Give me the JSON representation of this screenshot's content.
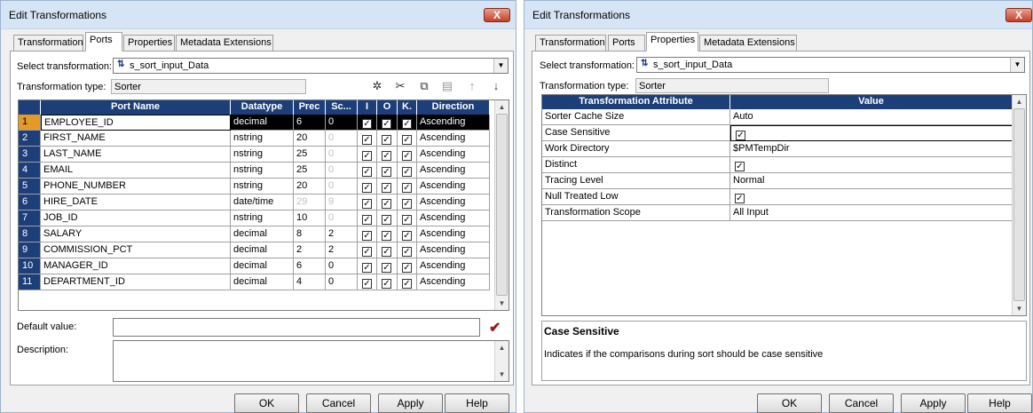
{
  "left": {
    "title": "Edit Transformations",
    "close": "X",
    "tabs": [
      "Transformation",
      "Ports",
      "Properties",
      "Metadata Extensions"
    ],
    "select_label": "Select transformation:",
    "select_value": "s_sort_input_Data",
    "type_label": "Transformation type:",
    "type_value": "Sorter",
    "toolbar_icons": [
      "new-port-icon",
      "cut-icon",
      "copy-icon",
      "paste-icon",
      "move-up-icon",
      "move-down-icon"
    ],
    "columns": [
      "",
      "Port Name",
      "Datatype",
      "Prec",
      "Sc...",
      "I",
      "O",
      "K.",
      "Direction"
    ],
    "rows": [
      {
        "n": "1",
        "name": "EMPLOYEE_ID",
        "type": "decimal",
        "prec": "6",
        "scale": "0",
        "scale_disabled": false,
        "prec_disabled": false,
        "dir": "Ascending"
      },
      {
        "n": "2",
        "name": "FIRST_NAME",
        "type": "nstring",
        "prec": "20",
        "scale": "0",
        "scale_disabled": true,
        "prec_disabled": false,
        "dir": "Ascending"
      },
      {
        "n": "3",
        "name": "LAST_NAME",
        "type": "nstring",
        "prec": "25",
        "scale": "0",
        "scale_disabled": true,
        "prec_disabled": false,
        "dir": "Ascending"
      },
      {
        "n": "4",
        "name": "EMAIL",
        "type": "nstring",
        "prec": "25",
        "scale": "0",
        "scale_disabled": true,
        "prec_disabled": false,
        "dir": "Ascending"
      },
      {
        "n": "5",
        "name": "PHONE_NUMBER",
        "type": "nstring",
        "prec": "20",
        "scale": "0",
        "scale_disabled": true,
        "prec_disabled": false,
        "dir": "Ascending"
      },
      {
        "n": "6",
        "name": "HIRE_DATE",
        "type": "date/time",
        "prec": "29",
        "scale": "9",
        "scale_disabled": true,
        "prec_disabled": true,
        "dir": "Ascending"
      },
      {
        "n": "7",
        "name": "JOB_ID",
        "type": "nstring",
        "prec": "10",
        "scale": "0",
        "scale_disabled": true,
        "prec_disabled": false,
        "dir": "Ascending"
      },
      {
        "n": "8",
        "name": "SALARY",
        "type": "decimal",
        "prec": "8",
        "scale": "2",
        "scale_disabled": false,
        "prec_disabled": false,
        "dir": "Ascending"
      },
      {
        "n": "9",
        "name": "COMMISSION_PCT",
        "type": "decimal",
        "prec": "2",
        "scale": "2",
        "scale_disabled": false,
        "prec_disabled": false,
        "dir": "Ascending"
      },
      {
        "n": "10",
        "name": "MANAGER_ID",
        "type": "decimal",
        "prec": "6",
        "scale": "0",
        "scale_disabled": false,
        "prec_disabled": false,
        "dir": "Ascending"
      },
      {
        "n": "11",
        "name": "DEPARTMENT_ID",
        "type": "decimal",
        "prec": "4",
        "scale": "0",
        "scale_disabled": false,
        "prec_disabled": false,
        "dir": "Ascending"
      }
    ],
    "default_label": "Default value:",
    "description_label": "Description:",
    "buttons": [
      "OK",
      "Cancel",
      "Apply",
      "Help"
    ]
  },
  "right": {
    "title": "Edit Transformations",
    "close": "X",
    "tabs": [
      "Transformation",
      "Ports",
      "Properties",
      "Metadata Extensions"
    ],
    "select_label": "Select transformation:",
    "select_value": "s_sort_input_Data",
    "type_label": "Transformation type:",
    "type_value": "Sorter",
    "columns": [
      "Transformation Attribute",
      "Value"
    ],
    "props": [
      {
        "attr": "Sorter Cache Size",
        "value": "Auto",
        "check": false
      },
      {
        "attr": "Case Sensitive",
        "value": "",
        "check": true
      },
      {
        "attr": "Work Directory",
        "value": "$PMTempDir",
        "check": false
      },
      {
        "attr": "Distinct",
        "value": "",
        "check": true
      },
      {
        "attr": "Tracing Level",
        "value": "Normal",
        "check": false
      },
      {
        "attr": "Null Treated Low",
        "value": "",
        "check": true
      },
      {
        "attr": "Transformation Scope",
        "value": "All Input",
        "check": false
      }
    ],
    "desc_title": "Case Sensitive",
    "desc_text": "Indicates if the comparisons during sort should be case sensitive",
    "buttons": [
      "OK",
      "Cancel",
      "Apply",
      "Help"
    ]
  },
  "colors": {
    "header": "#1c3f7a",
    "selected_row_num": "#e39a28",
    "titlebar": "#d6e5f5",
    "close": "#c2402a"
  }
}
